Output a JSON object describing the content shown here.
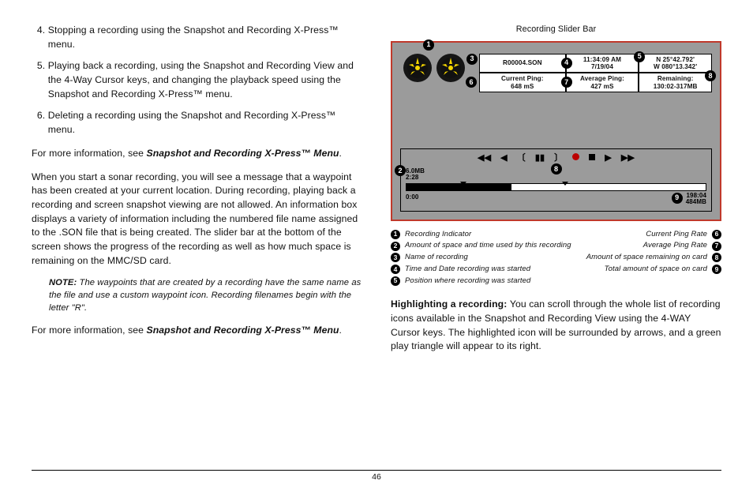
{
  "left": {
    "steps": [
      {
        "n": "4.",
        "text_a": "Stopping a recording using the Snapshot and Recording X-Press",
        "tm1": "™",
        "text_b": "menu."
      },
      {
        "n": "5.",
        "text_a": "Playing back a recording, using the Snapshot and Recording View and the 4-Way Cursor keys, and changing the playback speed using the Snapshot and Recording X-Press",
        "tm1": "™",
        "text_b": "menu."
      },
      {
        "n": "6.",
        "text_a": "Deleting a recording using the Snapshot and Recording X-Press",
        "tm1": "™",
        "text_b": "menu."
      }
    ],
    "more_info_prefix": "For more information, see ",
    "more_info_ref": "Snapshot and Recording X-Press™ Menu",
    "body": "When you start a sonar recording, you will see a message that a waypoint has been created at your current location. During recording, playing back a recording and screen snapshot viewing are not allowed. An information box displays a variety of information including the numbered file name assigned to the .SON file that is being created.  The slider bar at the bottom of the screen shows the progress of the recording as well as how much space is remaining on the MMC/SD card.",
    "note_label": "NOTE: ",
    "note_text": "The waypoints that are created by a recording have the same name as the file and use a custom waypoint icon. Recording filenames begin with the letter \"R\"."
  },
  "right": {
    "figure_title": "Recording Slider Bar",
    "info": {
      "filename": "R00004.SON",
      "datetime_1": "11:34:09 AM",
      "datetime_2": "7/19/04",
      "pos_1": "N 25°42.792'",
      "pos_2": "W 080°13.342'",
      "cur_label": "Current Ping:",
      "cur_val": "648 mS",
      "avg_label": "Average Ping:",
      "avg_val": "427 mS",
      "rem_label": "Remaining:",
      "rem_val": "130:02-317MB"
    },
    "playback": {
      "size": "6.0MB",
      "time": "2:28",
      "elapsed": "0:00",
      "total_time": "198:04",
      "total_size": "484MB"
    },
    "callouts": {
      "a": "1",
      "b": "2",
      "c": "3",
      "d": "4",
      "e": "5",
      "f": "6",
      "g": "7",
      "h": "8",
      "i": "9"
    },
    "legend_left": [
      {
        "n": "1",
        "t": "Recording Indicator"
      },
      {
        "n": "2",
        "t": "Amount of space and time used by this recording"
      },
      {
        "n": "3",
        "t": "Name of recording"
      },
      {
        "n": "4",
        "t": "Time and Date recording was started"
      },
      {
        "n": "5",
        "t": "Position where recording was started"
      }
    ],
    "legend_right": [
      {
        "n": "6",
        "t": "Current Ping Rate"
      },
      {
        "n": "7",
        "t": "Average Ping Rate"
      },
      {
        "n": "8",
        "t": "Amount of space remaining on card"
      },
      {
        "n": "9",
        "t": "Total amount of space on card"
      }
    ],
    "highlight_label": "Highlighting a recording: ",
    "highlight_text": "You can scroll through the whole list of recording icons available in the Snapshot and Recording View using the 4-WAY Cursor keys. The highlighted icon will be surrounded by arrows, and a green play triangle will appear to its right."
  },
  "page_number": "46"
}
